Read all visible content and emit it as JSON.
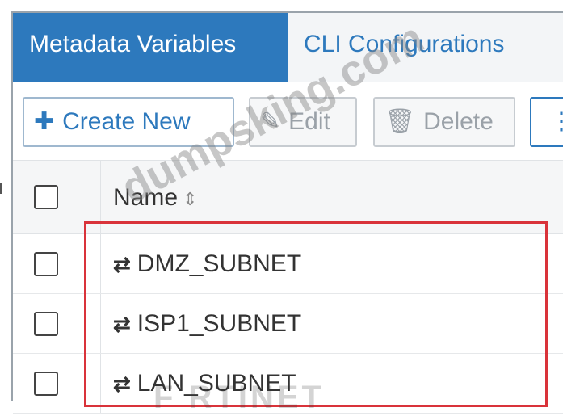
{
  "tabs": [
    {
      "label": "Metadata Variables",
      "active": true
    },
    {
      "label": "CLI Configurations",
      "active": false
    }
  ],
  "toolbar": {
    "create_label": "Create New",
    "edit_label": "Edit",
    "delete_label": "Delete",
    "more_label": "⋮"
  },
  "table": {
    "header": {
      "name": "Name"
    },
    "rows": [
      {
        "label": "DMZ_SUBNET"
      },
      {
        "label": "ISP1_SUBNET"
      },
      {
        "label": "LAN_SUBNET"
      }
    ]
  },
  "watermark": "dumpsking.com",
  "logo_watermark": "F  RTINET",
  "colors": {
    "accent": "#2d79bd",
    "highlight": "#d9333a"
  },
  "icons": {
    "create": "plus-icon",
    "edit": "edit-icon",
    "delete": "trash-icon",
    "sort": "sort-icon",
    "row": "subnet-icon"
  }
}
